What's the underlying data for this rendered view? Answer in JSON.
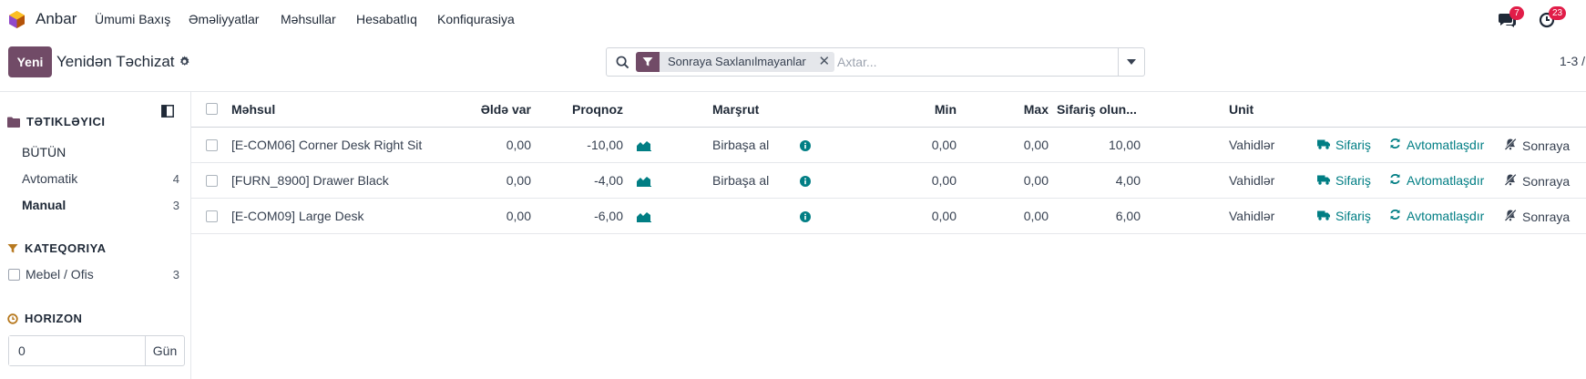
{
  "app": {
    "name": "Anbar",
    "logo_icon": "odoo-inventory-hex-icon"
  },
  "menu": [
    "Ümumi Baxış",
    "Əməliyyatlar",
    "Məhsullar",
    "Hesabatlıq",
    "Konfiqurasiya"
  ],
  "systray": {
    "messages_count": "7",
    "activities_count": "23"
  },
  "control": {
    "new_label": "Yeni",
    "breadcrumb": "Yenidən Təchizat",
    "search": {
      "facet": "Sonraya Saxlanılmayanlar",
      "placeholder": "Axtar..."
    },
    "pager": "1-3 /"
  },
  "sidepanel": {
    "trigger_title": "TƏTIKLƏYICI",
    "trigger_items": [
      {
        "label": "BÜTÜN",
        "count": ""
      },
      {
        "label": "Avtomatik",
        "count": "4"
      },
      {
        "label": "Manual",
        "count": "3"
      }
    ],
    "category_title": "KATEQORIYA",
    "category_items": [
      {
        "label": "Mebel / Ofis",
        "count": "3"
      }
    ],
    "horizon_title": "HORIZON",
    "horizon_value": "0",
    "horizon_unit": "Gün"
  },
  "table": {
    "columns": [
      "Məhsul",
      "Əldə var",
      "Proqnoz",
      "Marşrut",
      "Min",
      "Max",
      "Sifariş olun...",
      "Unit"
    ],
    "rows": [
      {
        "product": "[E-COM06] Corner Desk Right Sit",
        "on_hand": "0,00",
        "forecast": "-10,00",
        "route": "Birbaşa al",
        "min": "0,00",
        "max": "0,00",
        "to_order": "10,00",
        "unit": "Vahidlər"
      },
      {
        "product": "[FURN_8900] Drawer Black",
        "on_hand": "0,00",
        "forecast": "-4,00",
        "route": "Birbaşa al",
        "min": "0,00",
        "max": "0,00",
        "to_order": "4,00",
        "unit": "Vahidlər"
      },
      {
        "product": "[E-COM09] Large Desk",
        "on_hand": "0,00",
        "forecast": "-6,00",
        "route": "",
        "min": "0,00",
        "max": "0,00",
        "to_order": "6,00",
        "unit": "Vahidlər"
      }
    ],
    "actions": {
      "order": "Sifariş",
      "automate": "Avtomatlaşdır",
      "snooze": "Sonraya"
    }
  },
  "colors": {
    "brand": "#714b67",
    "action": "#017e84",
    "badge": "#e11d48"
  }
}
